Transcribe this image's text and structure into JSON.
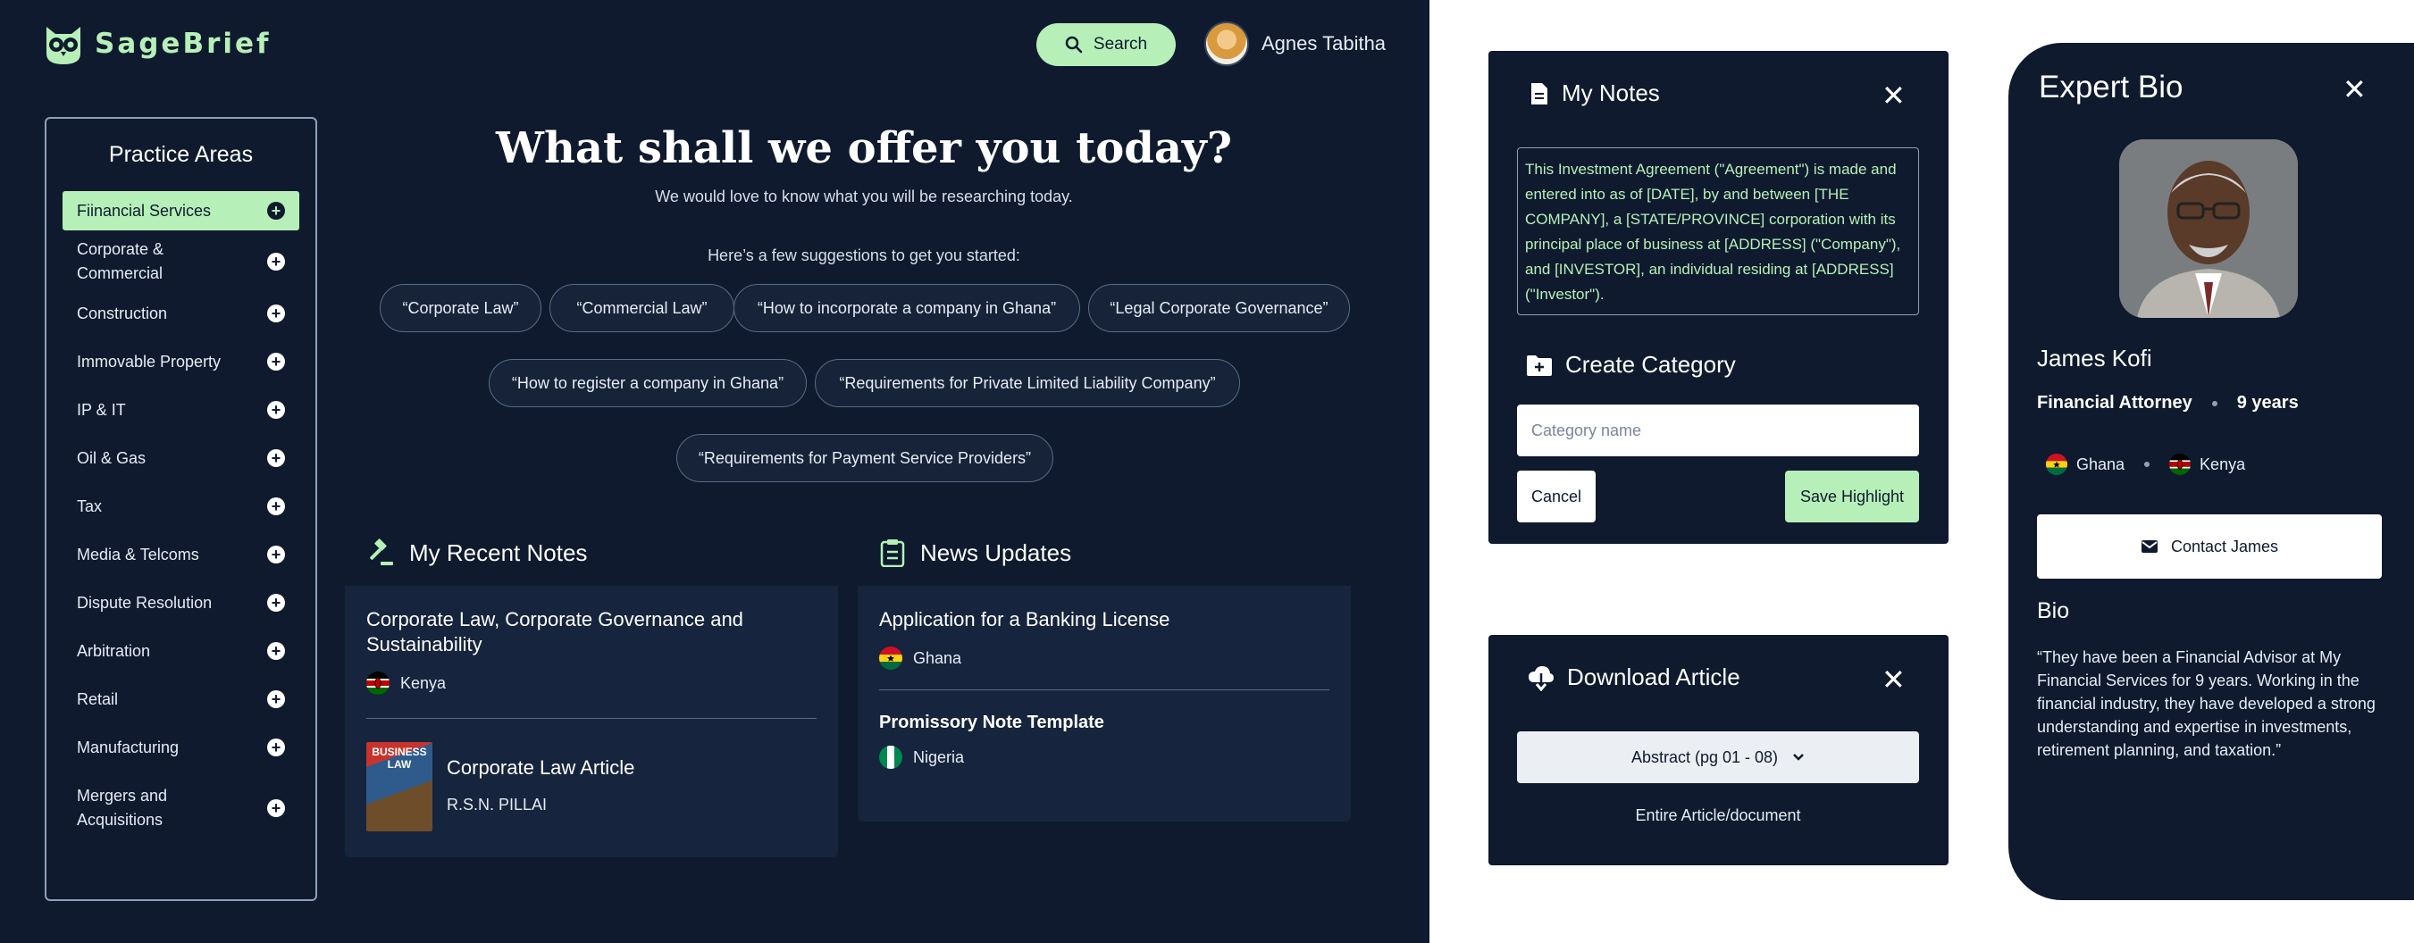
{
  "brand": {
    "name": "SageBrief"
  },
  "header": {
    "search_label": "Search",
    "user_name": "Agnes Tabitha"
  },
  "practice_areas": {
    "title": "Practice Areas",
    "items": [
      {
        "label": "Fiinancial Services"
      },
      {
        "label": "Corporate & Commercial"
      },
      {
        "label": "Construction"
      },
      {
        "label": "Immovable Property"
      },
      {
        "label": "IP & IT"
      },
      {
        "label": "Oil & Gas"
      },
      {
        "label": "Tax"
      },
      {
        "label": "Media & Telcoms"
      },
      {
        "label": "Dispute Resolution"
      },
      {
        "label": "Arbitration"
      },
      {
        "label": "Retail"
      },
      {
        "label": "Manufacturing"
      },
      {
        "label": "Mergers and Acquisitions"
      }
    ]
  },
  "hero": {
    "title": "What shall we offer you today?",
    "subtitle": "We would love to know what you will be researching today.",
    "suggestions_label": "Here’s a few suggestions to get you started:",
    "suggestions": [
      "“Corporate Law”",
      "“Commercial Law”",
      "“How to incorporate a company in Ghana”",
      "“Legal Corporate Governance”",
      "“How to register a company in Ghana”",
      "“Requirements for Private Limited Liability Company”",
      "“Requirements for Payment Service Providers”"
    ]
  },
  "recent_notes": {
    "title": "My Recent Notes",
    "note": {
      "title": "Corporate Law, Corporate Governance and Sustainability",
      "country": "Kenya"
    },
    "article": {
      "cover_text": "BUSINESS LAW",
      "title": "Corporate Law Article",
      "author": "R.S.N. PILLAI"
    }
  },
  "news": {
    "title": "News Updates",
    "items": [
      {
        "title": "Application for a Banking License",
        "country": "Ghana"
      },
      {
        "title": "Promissory Note Template",
        "country": "Nigeria"
      }
    ]
  },
  "my_notes": {
    "title": "My Notes",
    "text": "This Investment Agreement (\"Agreement\") is made and entered into as of [DATE], by and between [THE COMPANY], a [STATE/PROVINCE] corporation with its principal place of business at [ADDRESS] (\"Company\"), and [INVESTOR], an individual residing at [ADDRESS] (\"Investor\").",
    "create_category_title": "Create Category",
    "category_placeholder": "Category name",
    "cancel_label": "Cancel",
    "save_label": "Save Highlight"
  },
  "download": {
    "title": "Download Article",
    "selected_option": "Abstract (pg 01 - 08)",
    "entire_label": "Entire Article/document"
  },
  "expert_bio": {
    "title": "Expert Bio",
    "name": "James Kofi",
    "role": "Financial Attorney",
    "experience": "9 years",
    "countries": [
      "Ghana",
      "Kenya"
    ],
    "contact_label": "Contact James",
    "bio_label": "Bio",
    "bio_text": "“They have been a Financial Advisor at My Financial Services for 9 years. Working in the financial industry, they have developed a strong understanding and expertise in investments, retirement planning, and taxation.”"
  },
  "colors": {
    "navy": "#0f1a2e",
    "accent_green": "#b6f0b8",
    "card": "#17243d"
  }
}
